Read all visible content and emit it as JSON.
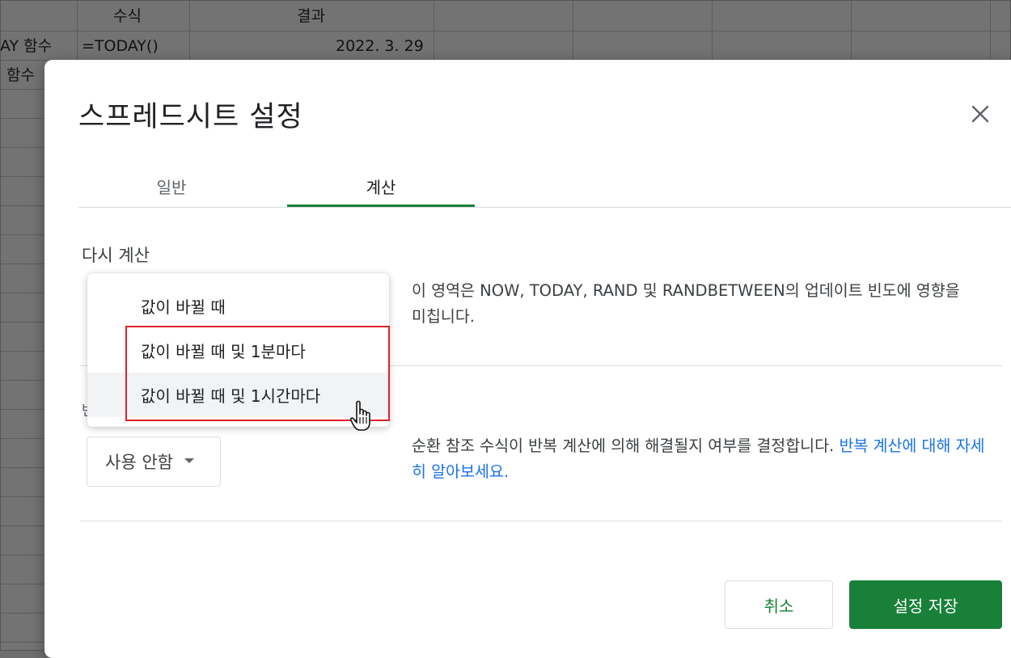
{
  "sheet": {
    "header_formula": "수식",
    "header_result": "결과",
    "row1_label": "AY 함수",
    "row1_formula": "=TODAY()",
    "row1_result": "2022. 3. 29",
    "row2_label": "함수"
  },
  "dialog": {
    "title": "스프레드시트 설정",
    "close_icon": "close-icon",
    "tabs": [
      {
        "label": "일반"
      },
      {
        "label": "계산"
      }
    ],
    "recalc": {
      "label": "다시 계산",
      "description": "이 영역은 NOW, TODAY, RAND 및 RANDBETWEEN의 업데이트 빈도에 영향을 미칩니다.",
      "options": [
        {
          "label": "값이 바뀔 때"
        },
        {
          "label": "값이 바뀔 때 및 1분마다"
        },
        {
          "label": "값이 바뀔 때 및 1시간마다"
        }
      ]
    },
    "iterative": {
      "partial_label": "반",
      "dropdown_value": "사용 안함",
      "description": "순환 참조 수식이 반복 계산에 의해 해결될지 여부를 결정합니다. ",
      "link_text": "반복 계산에 대해 자세히 알아보세요."
    },
    "buttons": {
      "cancel": "취소",
      "save": "설정 저장"
    }
  },
  "colors": {
    "accent_green": "#188038",
    "link_blue": "#1a73e8",
    "highlight_red": "#e0202a"
  }
}
